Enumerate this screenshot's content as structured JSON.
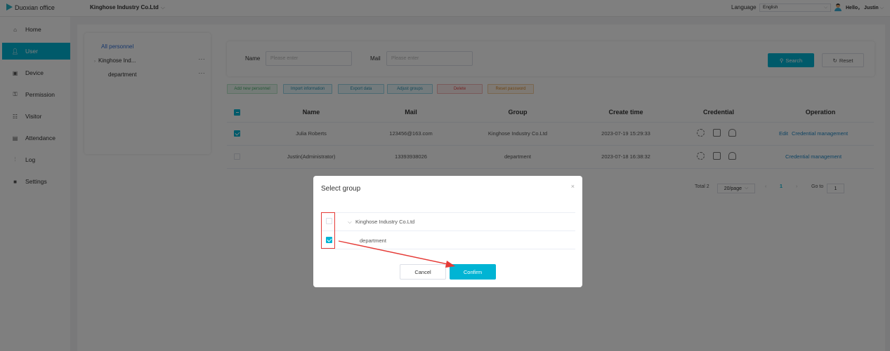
{
  "topbar": {
    "logo_text": "Duoxian office",
    "company": "Kinghose Industry Co.Ltd",
    "language_label": "Language",
    "language_value": "English",
    "greeting": "Hello， Justin"
  },
  "sidebar": {
    "items": [
      {
        "label": "Home",
        "icon": "home-icon"
      },
      {
        "label": "User",
        "icon": "user-icon"
      },
      {
        "label": "Device",
        "icon": "device-icon"
      },
      {
        "label": "Permission",
        "icon": "permission-icon"
      },
      {
        "label": "Visitor",
        "icon": "visitor-icon"
      },
      {
        "label": "Attendance",
        "icon": "attendance-icon"
      },
      {
        "label": "Log",
        "icon": "log-icon"
      },
      {
        "label": "Settings",
        "icon": "settings-icon"
      }
    ],
    "active": "User"
  },
  "tree": {
    "all_label": "All personnel",
    "company": "Kinghose Ind...",
    "department": "department",
    "more": "···"
  },
  "filter": {
    "name_label": "Name",
    "name_placeholder": "Please enter",
    "mail_label": "Mail",
    "mail_placeholder": "Please enter",
    "search_label": "Search",
    "reset_label": "Reset"
  },
  "actions": {
    "add": "Add new personnel",
    "import": "Import information",
    "export": "Export data",
    "adjust": "Adjust groups",
    "delete": "Delete",
    "reset_pw": "Reset password"
  },
  "table": {
    "headers": [
      "Name",
      "Mail",
      "Group",
      "Create time",
      "Credential",
      "Operation"
    ],
    "rows": [
      {
        "checked": true,
        "name": "Julia Roberts",
        "mail": "123456@163.com",
        "group": "Kinghose Industry Co.Ltd",
        "created": "2023-07-19 15:29:33",
        "edit": "Edit",
        "op": "Credential management"
      },
      {
        "checked": false,
        "name": "Justin(Administrator)",
        "mail": "13393938026",
        "group": "department",
        "created": "2023-07-18 16:38:32",
        "edit": "",
        "op": "Credential management"
      }
    ]
  },
  "pagination": {
    "total": "Total 2",
    "page_size": "20/page",
    "current": "1",
    "goto_label": "Go to",
    "goto_value": "1"
  },
  "modal": {
    "title": "Select group",
    "close": "×",
    "items": [
      {
        "label": "Kinghose Industry Co.Ltd",
        "checked": false
      },
      {
        "label": "department",
        "checked": true
      }
    ],
    "cancel": "Cancel",
    "confirm": "Confirm"
  },
  "colors": {
    "accent": "#00b4d4",
    "annotation": "#e53935"
  }
}
